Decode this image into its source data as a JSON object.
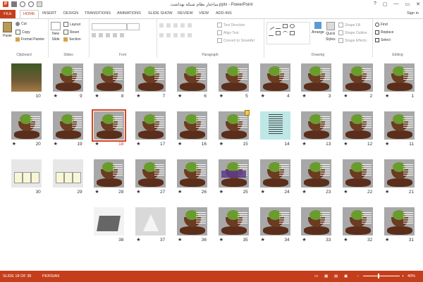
{
  "window": {
    "title": "ساختار نظام شبکه بهداشت.pptx - PowerPoint",
    "controls": [
      "?",
      "▢",
      "—",
      "▭",
      "✕"
    ]
  },
  "tabs": [
    "FILE",
    "HOME",
    "INSERT",
    "DESIGN",
    "TRANSITIONS",
    "ANIMATIONS",
    "SLIDE SHOW",
    "REVIEW",
    "VIEW",
    "ADD-INS"
  ],
  "active_tab": "HOME",
  "sign_in": "Sign in",
  "ribbon": {
    "clipboard": {
      "label": "Clipboard",
      "paste": "Paste",
      "cut": "Cut",
      "copy": "Copy",
      "format_painter": "Format Painter"
    },
    "slides": {
      "label": "Slides",
      "new_slide": "New",
      "new_slide_2": "Slide",
      "layout": "Layout",
      "reset": "Reset",
      "section": "Section"
    },
    "font": {
      "label": "Font"
    },
    "paragraph": {
      "label": "Paragraph",
      "text_direction": "Text Direction",
      "align_text": "Align Text",
      "convert_smartart": "Convert to SmartArt"
    },
    "drawing": {
      "label": "Drawing",
      "arrange": "Arrange",
      "quick_styles": "Quick",
      "quick_styles_2": "Styles",
      "shape_fill": "Shape Fill",
      "shape_outline": "Shape Outline",
      "shape_effects": "Shape Effects"
    },
    "editing": {
      "label": "Editing",
      "find": "Find",
      "replace": "Replace",
      "select": "Select"
    }
  },
  "slides": [
    {
      "n": "1"
    },
    {
      "n": "2"
    },
    {
      "n": "3"
    },
    {
      "n": "4"
    },
    {
      "n": "5"
    },
    {
      "n": "6"
    },
    {
      "n": "7"
    },
    {
      "n": "8"
    },
    {
      "n": "9"
    },
    {
      "n": "10"
    },
    {
      "n": "11"
    },
    {
      "n": "12"
    },
    {
      "n": "13"
    },
    {
      "n": "14"
    },
    {
      "n": "15"
    },
    {
      "n": "16"
    },
    {
      "n": "17"
    },
    {
      "n": "18"
    },
    {
      "n": "19"
    },
    {
      "n": "20"
    },
    {
      "n": "21"
    },
    {
      "n": "22"
    },
    {
      "n": "23"
    },
    {
      "n": "24"
    },
    {
      "n": "25"
    },
    {
      "n": "26"
    },
    {
      "n": "27"
    },
    {
      "n": "28"
    },
    {
      "n": "29"
    },
    {
      "n": "30"
    },
    {
      "n": "31"
    },
    {
      "n": "32"
    },
    {
      "n": "33"
    },
    {
      "n": "34"
    },
    {
      "n": "35"
    },
    {
      "n": "36"
    },
    {
      "n": "37"
    },
    {
      "n": "38"
    }
  ],
  "star": "★",
  "selected_slide": "18",
  "status": {
    "slide_info": "SLIDE 18 OF 38",
    "language": "PERSIAN",
    "zoom": "40%",
    "zoom_fraction": 0.4
  },
  "colors": {
    "accent": "#c43e1c",
    "selection": "#d24726"
  }
}
